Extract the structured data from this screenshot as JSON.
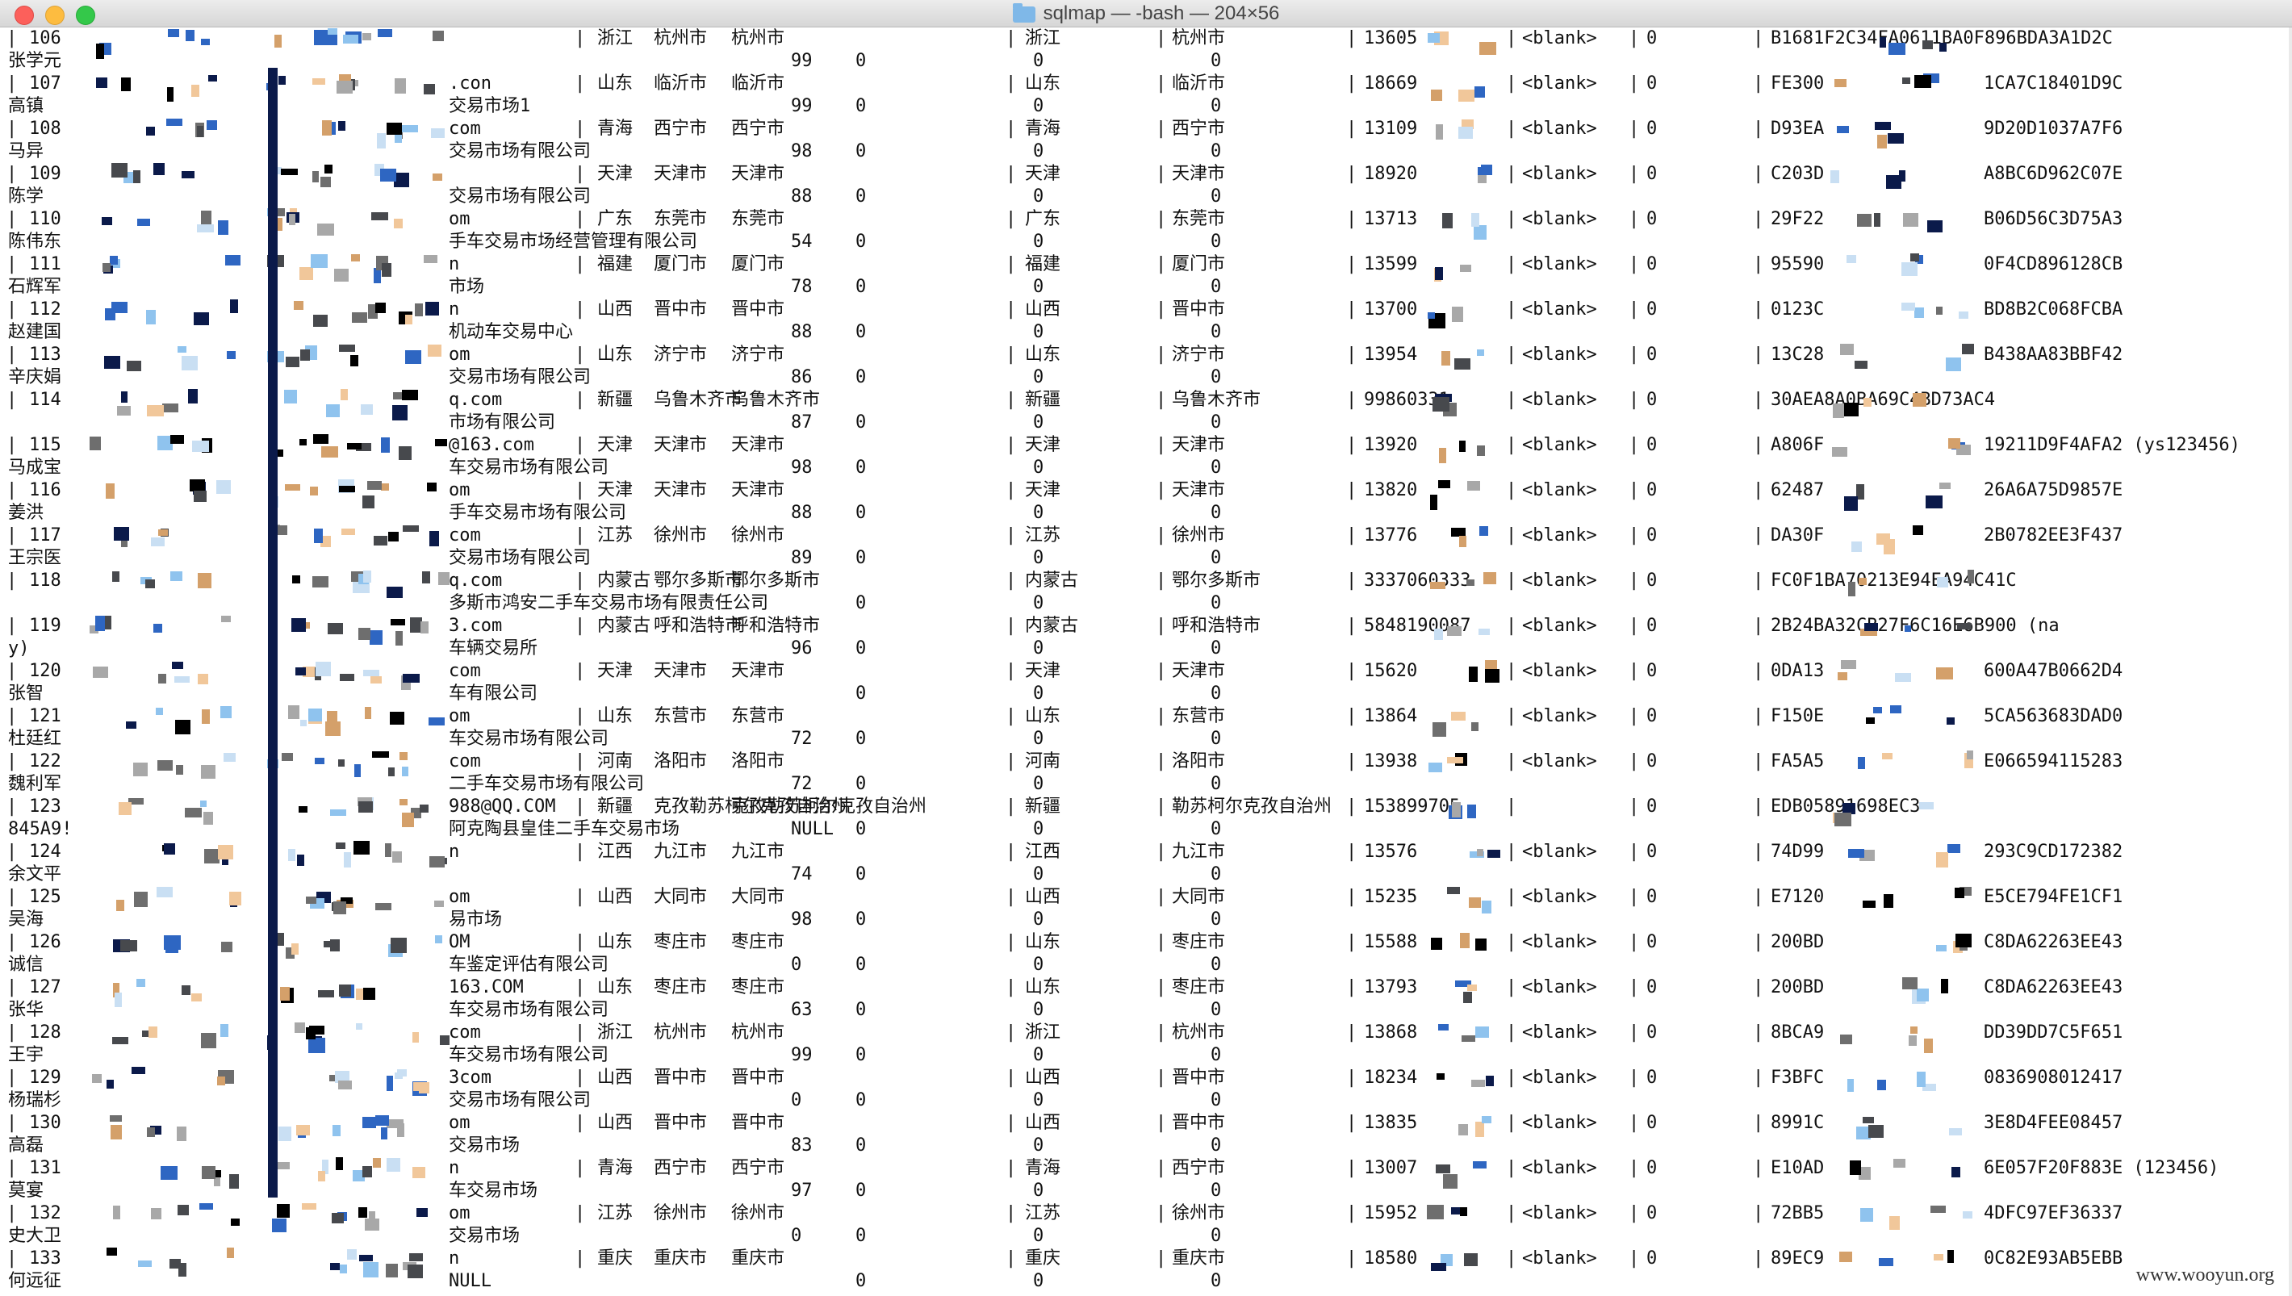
{
  "window": {
    "title": "sqlmap — -bash — 204×56",
    "folder_icon": "folder-icon"
  },
  "watermark": "www.wooyun.org",
  "colors": {
    "pixel_palette": [
      "#0b1a4a",
      "#000000",
      "#8fc3ee",
      "#c9dff3",
      "#2e66c2",
      "#6e6e6e",
      "#d4a06a",
      "#a8a8a8",
      "#f1c79a",
      "#47494d"
    ]
  },
  "records": [
    {
      "id": "106",
      "name": "张学元",
      "email_tail": "",
      "province": "浙江",
      "city": "杭州市",
      "region": "杭州市",
      "prov2": "浙江",
      "city2": "杭州市",
      "phone": "13605",
      "blank": "<blank>",
      "zero": "0",
      "hash": "B1681F2C34FA0611BA0F896BDA3A1D2C",
      "company": "",
      "score": "99",
      "z1": "0",
      "z2": "0",
      "z3": "0"
    },
    {
      "id": "107",
      "name": "高镇",
      "email_tail": ".con",
      "province": "山东",
      "city": "临沂市",
      "region": "临沂市",
      "prov2": "山东",
      "city2": "临沂市",
      "phone": "18669",
      "blank": "<blank>",
      "zero": "0",
      "hash": "FE300",
      "hash2": "1CA7C18401D9C",
      "company": "交易市场1",
      "score": "99",
      "z1": "0",
      "z2": "0",
      "z3": "0"
    },
    {
      "id": "108",
      "name": "马异",
      "email_tail": "com",
      "province": "青海",
      "city": "西宁市",
      "region": "西宁市",
      "prov2": "青海",
      "city2": "西宁市",
      "phone": "13109",
      "blank": "<blank>",
      "zero": "0",
      "hash": "D93EA",
      "hash2": "9D20D1037A7F6",
      "company": "交易市场有限公司",
      "score": "98",
      "z1": "0",
      "z2": "0",
      "z3": "0"
    },
    {
      "id": "109",
      "name": "陈学",
      "email_tail": "",
      "province": "天津",
      "city": "天津市",
      "region": "天津市",
      "prov2": "天津",
      "city2": "天津市",
      "phone": "18920",
      "blank": "<blank>",
      "zero": "0",
      "hash": "C203D",
      "hash2": "A8BC6D962C07E",
      "company": "交易市场有限公司",
      "score": "88",
      "z1": "0",
      "z2": "0",
      "z3": "0"
    },
    {
      "id": "110",
      "name": "陈伟东",
      "email_tail": "om",
      "province": "广东",
      "city": "东莞市",
      "region": "东莞市",
      "prov2": "广东",
      "city2": "东莞市",
      "phone": "13713",
      "blank": "<blank>",
      "zero": "0",
      "hash": "29F22",
      "hash2": "B06D56C3D75A3",
      "company": "手车交易市场经营管理有限公司",
      "score": "54",
      "z1": "0",
      "z2": "0",
      "z3": "0"
    },
    {
      "id": "111",
      "name": "石辉军",
      "email_tail": "n",
      "province": "福建",
      "city": "厦门市",
      "region": "厦门市",
      "prov2": "福建",
      "city2": "厦门市",
      "phone": "13599",
      "blank": "<blank>",
      "zero": "0",
      "hash": "95590",
      "hash2": "0F4CD896128CB",
      "company": "市场",
      "score": "78",
      "z1": "0",
      "z2": "0",
      "z3": "0"
    },
    {
      "id": "112",
      "name": "赵建国",
      "email_tail": "n",
      "province": "山西",
      "city": "晋中市",
      "region": "晋中市",
      "prov2": "山西",
      "city2": "晋中市",
      "phone": "13700",
      "blank": "<blank>",
      "zero": "0",
      "hash": "0123C",
      "hash2": "BD8B2C068FCBA",
      "company": "机动车交易中心",
      "score": "88",
      "z1": "0",
      "z2": "0",
      "z3": "0"
    },
    {
      "id": "113",
      "name": "辛庆娟",
      "email_tail": "om",
      "province": "山东",
      "city": "济宁市",
      "region": "济宁市",
      "prov2": "山东",
      "city2": "济宁市",
      "phone": "13954",
      "blank": "<blank>",
      "zero": "0",
      "hash": "13C28",
      "hash2": "B438AA83BBF42",
      "company": "交易市场有限公司",
      "score": "86",
      "z1": "0",
      "z2": "0",
      "z3": "0"
    },
    {
      "id": "114",
      "name": "",
      "email_tail": "q.com",
      "province": "新疆",
      "city": "乌鲁木齐市",
      "region": "乌鲁木齐市",
      "prov2": "新疆",
      "city2": "乌鲁木齐市",
      "phone": "99860331",
      "blank": "<blank>",
      "zero": "0",
      "hash": "30AEA8A0BA69C4BD73AC4",
      "hash2": "",
      "company": "市场有限公司",
      "score": "87",
      "z1": "0",
      "z2": "0",
      "z3": "0"
    },
    {
      "id": "115",
      "name": "马成宝",
      "email_tail": "@163.com",
      "province": "天津",
      "city": "天津市",
      "region": "天津市",
      "prov2": "天津",
      "city2": "天津市",
      "phone": "13920",
      "blank": "<blank>",
      "zero": "0",
      "hash": "A806F",
      "hash2": "19211D9F4AFA2 (ys123456)",
      "company": "车交易市场有限公司",
      "score": "98",
      "z1": "0",
      "z2": "0",
      "z3": "0"
    },
    {
      "id": "116",
      "name": "姜洪",
      "email_tail": "om",
      "province": "天津",
      "city": "天津市",
      "region": "天津市",
      "prov2": "天津",
      "city2": "天津市",
      "phone": "13820",
      "blank": "<blank>",
      "zero": "0",
      "hash": "62487",
      "hash2": "26A6A75D9857E",
      "company": "手车交易市场有限公司",
      "score": "88",
      "z1": "0",
      "z2": "0",
      "z3": "0"
    },
    {
      "id": "117",
      "name": "王宗医",
      "email_tail": "com",
      "province": "江苏",
      "city": "徐州市",
      "region": "徐州市",
      "prov2": "江苏",
      "city2": "徐州市",
      "phone": "13776",
      "blank": "<blank>",
      "zero": "0",
      "hash": "DA30F",
      "hash2": "2B0782EE3F437",
      "company": "交易市场有限公司",
      "score": "89",
      "z1": "0",
      "z2": "0",
      "z3": "0"
    },
    {
      "id": "118",
      "name": "",
      "email_tail": "q.com",
      "province": "内蒙古",
      "city": "鄂尔多斯市",
      "region": "鄂尔多斯市",
      "prov2": "内蒙古",
      "city2": "鄂尔多斯市",
      "phone": "3337060333",
      "blank": "<blank>",
      "zero": "0",
      "hash": "FC0F1BA70213E94EA94C41C",
      "hash2": "",
      "company": "多斯市鸿安二手车交易市场有限责任公司",
      "score": "",
      "z1": "0",
      "z2": "0",
      "z3": "0"
    },
    {
      "id": "119",
      "name": "y)",
      "email_tail": "3.com",
      "province": "内蒙古",
      "city": "呼和浩特市",
      "region": "呼和浩特市",
      "prov2": "内蒙古",
      "city2": "呼和浩特市",
      "phone": "5848190087",
      "blank": "<blank>",
      "zero": "0",
      "hash": "2B24BA32CB27F6C16E6B900 (na",
      "hash2": "",
      "company": "车辆交易所",
      "score": "96",
      "z1": "0",
      "z2": "0",
      "z3": "0"
    },
    {
      "id": "120",
      "name": "张智",
      "email_tail": "com",
      "province": "天津",
      "city": "天津市",
      "region": "天津市",
      "prov2": "天津",
      "city2": "天津市",
      "phone": "15620",
      "blank": "<blank>",
      "zero": "0",
      "hash": "0DA13",
      "hash2": "600A47B0662D4",
      "company": "车有限公司",
      "score": "",
      "z1": "0",
      "z2": "0",
      "z3": "0"
    },
    {
      "id": "121",
      "name": "杜廷红",
      "email_tail": "om",
      "province": "山东",
      "city": "东营市",
      "region": "东营市",
      "prov2": "山东",
      "city2": "东营市",
      "phone": "13864",
      "blank": "<blank>",
      "zero": "0",
      "hash": "F150E",
      "hash2": "5CA563683DAD0",
      "company": "车交易市场有限公司",
      "score": "72",
      "z1": "0",
      "z2": "0",
      "z3": "0"
    },
    {
      "id": "122",
      "name": "魏利军",
      "email_tail": "com",
      "province": "河南",
      "city": "洛阳市",
      "region": "洛阳市",
      "prov2": "河南",
      "city2": "洛阳市",
      "phone": "13938",
      "blank": "<blank>",
      "zero": "0",
      "hash": "FA5A5",
      "hash2": "E066594115283",
      "company": "二手车交易市场有限公司",
      "score": "72",
      "z1": "0",
      "z2": "0",
      "z3": "0"
    },
    {
      "id": "123",
      "name": "845A9!",
      "email_tail": "988@QQ.COM",
      "province": "新疆",
      "city": "克孜勒苏柯尔克孜自治州",
      "region": "克孜勒苏柯尔克孜自治州",
      "prov2": "新疆",
      "city2": "勒苏柯尔克孜自治州",
      "phone": "153899705",
      "blank": "",
      "zero": "0",
      "hash": "EDB05891698EC3",
      "hash2": "",
      "company": "阿克陶县皇佳二手车交易市场",
      "score": "NULL",
      "z1": "0",
      "z2": "0",
      "z3": "0"
    },
    {
      "id": "124",
      "name": "余文平",
      "email_tail": "n",
      "province": "江西",
      "city": "九江市",
      "region": "九江市",
      "prov2": "江西",
      "city2": "九江市",
      "phone": "13576",
      "blank": "<blank>",
      "zero": "0",
      "hash": "74D99",
      "hash2": "293C9CD172382",
      "company": "",
      "score": "74",
      "z1": "0",
      "z2": "0",
      "z3": "0"
    },
    {
      "id": "125",
      "name": "吴海",
      "email_tail": "om",
      "province": "山西",
      "city": "大同市",
      "region": "大同市",
      "prov2": "山西",
      "city2": "大同市",
      "phone": "15235",
      "blank": "<blank>",
      "zero": "0",
      "hash": "E7120",
      "hash2": "E5CE794FE1CF1",
      "company": "易市场",
      "score": "98",
      "z1": "0",
      "z2": "0",
      "z3": "0"
    },
    {
      "id": "126",
      "name": "诚信",
      "email_tail": "OM",
      "province": "山东",
      "city": "枣庄市",
      "region": "枣庄市",
      "prov2": "山东",
      "city2": "枣庄市",
      "phone": "15588",
      "blank": "<blank>",
      "zero": "0",
      "hash": "200BD",
      "hash2": "C8DA62263EE43",
      "company": "车鉴定评估有限公司",
      "score": "0",
      "z1": "0",
      "z2": "0",
      "z3": "0"
    },
    {
      "id": "127",
      "name": "张华",
      "email_tail": "163.COM",
      "province": "山东",
      "city": "枣庄市",
      "region": "枣庄市",
      "prov2": "山东",
      "city2": "枣庄市",
      "phone": "13793",
      "blank": "<blank>",
      "zero": "0",
      "hash": "200BD",
      "hash2": "C8DA62263EE43",
      "company": "车交易市场有限公司",
      "score": "63",
      "z1": "0",
      "z2": "0",
      "z3": "0"
    },
    {
      "id": "128",
      "name": "王宇",
      "email_tail": "com",
      "province": "浙江",
      "city": "杭州市",
      "region": "杭州市",
      "prov2": "浙江",
      "city2": "杭州市",
      "phone": "13868",
      "blank": "<blank>",
      "zero": "0",
      "hash": "8BCA9",
      "hash2": "DD39DD7C5F651",
      "company": "车交易市场有限公司",
      "score": "99",
      "z1": "0",
      "z2": "0",
      "z3": "0"
    },
    {
      "id": "129",
      "name": "杨瑞杉",
      "email_tail": "3com",
      "province": "山西",
      "city": "晋中市",
      "region": "晋中市",
      "prov2": "山西",
      "city2": "晋中市",
      "phone": "18234",
      "blank": "<blank>",
      "zero": "0",
      "hash": "F3BFC",
      "hash2": "0836908012417",
      "company": "交易市场有限公司",
      "score": "0",
      "z1": "0",
      "z2": "0",
      "z3": "0"
    },
    {
      "id": "130",
      "name": "高磊",
      "email_tail": "om",
      "province": "山西",
      "city": "晋中市",
      "region": "晋中市",
      "prov2": "山西",
      "city2": "晋中市",
      "phone": "13835",
      "blank": "<blank>",
      "zero": "0",
      "hash": "8991C",
      "hash2": "3E8D4FEE08457",
      "company": "交易市场",
      "score": "83",
      "z1": "0",
      "z2": "0",
      "z3": "0"
    },
    {
      "id": "131",
      "name": "莫宴",
      "email_tail": "n",
      "province": "青海",
      "city": "西宁市",
      "region": "西宁市",
      "prov2": "青海",
      "city2": "西宁市",
      "phone": "13007",
      "blank": "<blank>",
      "zero": "0",
      "hash": "E10AD",
      "hash2": "6E057F20F883E (123456)",
      "company": "车交易市场",
      "score": "97",
      "z1": "0",
      "z2": "0",
      "z3": "0"
    },
    {
      "id": "132",
      "name": "史大卫",
      "email_tail": "om",
      "province": "江苏",
      "city": "徐州市",
      "region": "徐州市",
      "prov2": "江苏",
      "city2": "徐州市",
      "phone": "15952",
      "blank": "<blank>",
      "zero": "0",
      "hash": "72BB5",
      "hash2": "4DFC97EF36337",
      "company": "交易市场",
      "score": "0",
      "z1": "0",
      "z2": "0",
      "z3": "0"
    },
    {
      "id": "133",
      "name": "何远征",
      "email_tail": "n",
      "province": "重庆",
      "city": "重庆市",
      "region": "重庆市",
      "prov2": "重庆",
      "city2": "重庆市",
      "phone": "18580",
      "blank": "<blank>",
      "zero": "0",
      "hash": "89EC9",
      "hash2": "0C82E93AB5EBB",
      "company": "NULL",
      "score": "",
      "z1": "0",
      "z2": "0",
      "z3": "0"
    }
  ]
}
